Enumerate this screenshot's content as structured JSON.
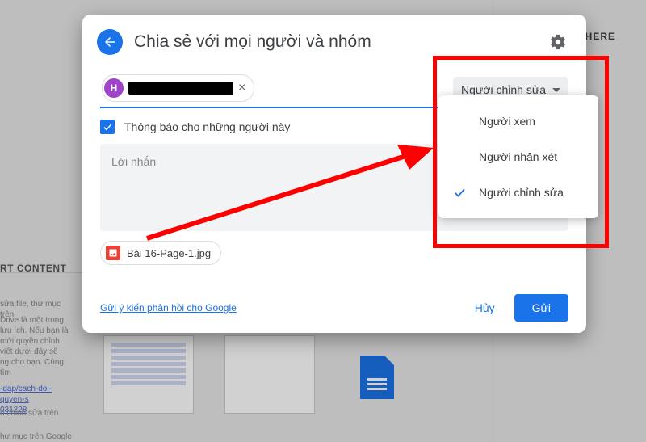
{
  "header": {
    "title": "Chia sẻ với mọi người và nhóm"
  },
  "recipient": {
    "initial": "H",
    "remove_title": "Xóa"
  },
  "permission_button": {
    "label": "Người chỉnh sửa"
  },
  "notify": {
    "label": "Thông báo cho những người này"
  },
  "message": {
    "placeholder": "Lời nhắn"
  },
  "attachment": {
    "name": "Bài 16-Page-1.jpg"
  },
  "footer": {
    "feedback": "Gửi ý kiến phản hồi cho Google",
    "cancel": "Hủy",
    "send": "Gửi"
  },
  "menu": {
    "items": [
      {
        "label": "Người xem",
        "checked": false
      },
      {
        "label": "Người nhận xét",
        "checked": false
      },
      {
        "label": "Người chỉnh sửa",
        "checked": true
      }
    ]
  },
  "background": {
    "here_badge": "HERE",
    "content_label": "RT CONTENT",
    "desc_line1": "sửa file, thư mục trên",
    "desc_par": "Drive là một trong\nlưu ích. Nếu bạn là\nmới quyền chỉnh\nviết dưới đây sẽ\nng cho bạn. Cùng tìm",
    "link": "-dap/cach-doi-quyen-s\n031228",
    "desc_line2": "n chỉnh sửa trên",
    "desc_line3": "hư mục trên Google"
  }
}
